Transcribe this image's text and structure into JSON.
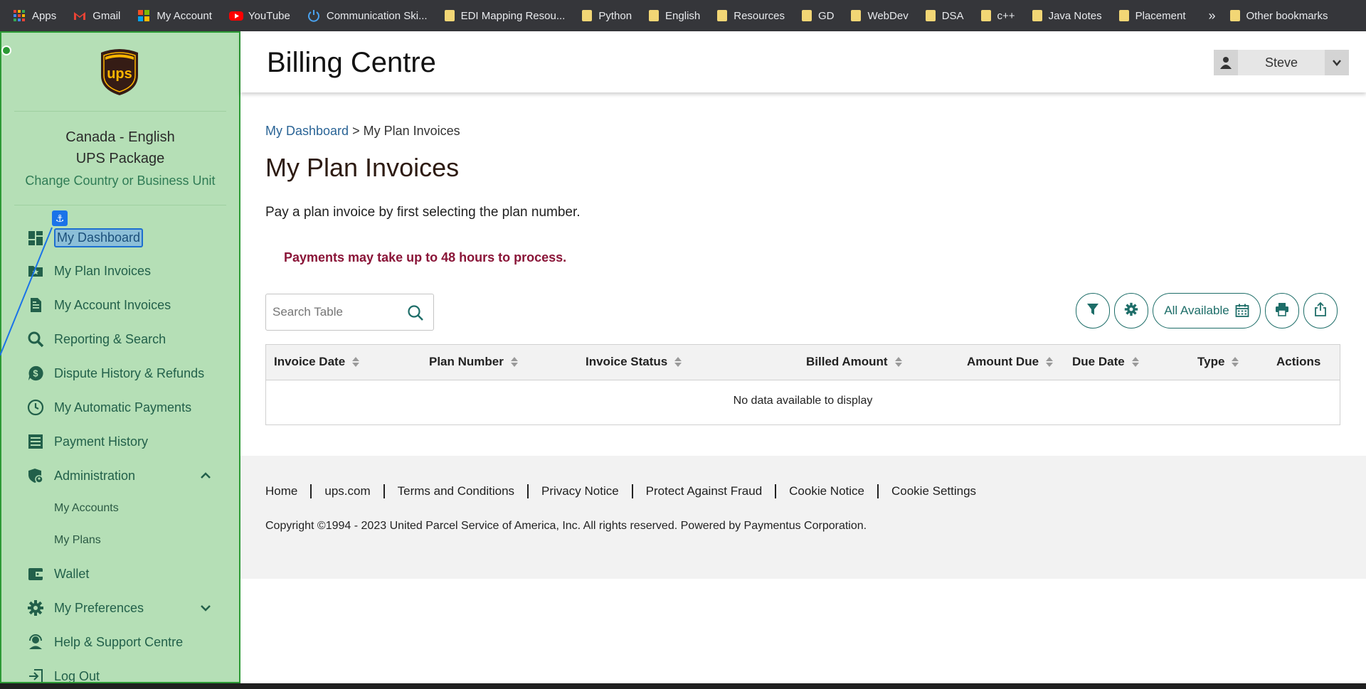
{
  "bookmarks": [
    {
      "label": "Apps",
      "icon": "apps-grid-icon"
    },
    {
      "label": "Gmail",
      "icon": "gmail-icon"
    },
    {
      "label": "My Account",
      "icon": "microsoft-icon"
    },
    {
      "label": "YouTube",
      "icon": "youtube-icon"
    },
    {
      "label": "Communication Ski...",
      "icon": "power-icon"
    },
    {
      "label": "EDI Mapping Resou...",
      "icon": "folder-icon"
    },
    {
      "label": "Python",
      "icon": "folder-icon"
    },
    {
      "label": "English",
      "icon": "folder-icon"
    },
    {
      "label": "Resources",
      "icon": "folder-icon"
    },
    {
      "label": "GD",
      "icon": "folder-icon"
    },
    {
      "label": "WebDev",
      "icon": "folder-icon"
    },
    {
      "label": "DSA",
      "icon": "folder-icon"
    },
    {
      "label": "c++",
      "icon": "folder-icon"
    },
    {
      "label": "Java Notes",
      "icon": "folder-icon"
    },
    {
      "label": "Placement",
      "icon": "folder-icon"
    }
  ],
  "bookmarks_more": "»",
  "other_bookmarks": "Other bookmarks",
  "sidebar": {
    "locale_line1": "Canada - English",
    "locale_line2": "UPS Package",
    "change_link": "Change Country or Business Unit",
    "anchor_glyph": "⚓",
    "items": [
      {
        "label": "My Dashboard",
        "icon": "dashboard-icon"
      },
      {
        "label": "My Plan Invoices",
        "icon": "star-folder-icon"
      },
      {
        "label": "My Account Invoices",
        "icon": "document-icon"
      },
      {
        "label": "Reporting & Search",
        "icon": "search-icon"
      },
      {
        "label": "Dispute History & Refunds",
        "icon": "dollar-chat-icon"
      },
      {
        "label": "My Automatic Payments",
        "icon": "clock-icon"
      },
      {
        "label": "Payment History",
        "icon": "list-icon"
      },
      {
        "label": "Administration",
        "icon": "shield-user-icon"
      },
      {
        "label": "Wallet",
        "icon": "wallet-icon"
      },
      {
        "label": "My Preferences",
        "icon": "gear-icon"
      },
      {
        "label": "Help & Support Centre",
        "icon": "headset-icon"
      },
      {
        "label": "Log Out",
        "icon": "logout-icon"
      }
    ],
    "admin_sub": [
      "My Accounts",
      "My Plans"
    ]
  },
  "header": {
    "title": "Billing Centre",
    "user_name": "Steve"
  },
  "breadcrumb": {
    "link": "My Dashboard",
    "separator": ">",
    "current": "My Plan Invoices"
  },
  "page": {
    "title": "My Plan Invoices",
    "intro": "Pay a plan invoice by first selecting the plan number.",
    "warning": "Payments may take up to 48 hours to process."
  },
  "search": {
    "placeholder": "Search Table"
  },
  "toolbar": {
    "date_filter_label": "All Available"
  },
  "table": {
    "columns": [
      "Invoice Date",
      "Plan Number",
      "Invoice Status",
      "Billed Amount",
      "Amount Due",
      "Due Date",
      "Type",
      "Actions"
    ],
    "empty_message": "No data available to display"
  },
  "footer": {
    "links": [
      "Home",
      "ups.com",
      "Terms and Conditions",
      "Privacy Notice",
      "Protect Against Fraud",
      "Cookie Notice",
      "Cookie Settings"
    ],
    "copyright": "Copyright ©1994 - 2023 United Parcel Service of America, Inc. All rights reserved. Powered by Paymentus Corporation."
  },
  "colors": {
    "sidebar_bg": "#b5dfb6",
    "accent": "#1d6d68",
    "warning": "#8a1538",
    "link": "#2a6496"
  }
}
